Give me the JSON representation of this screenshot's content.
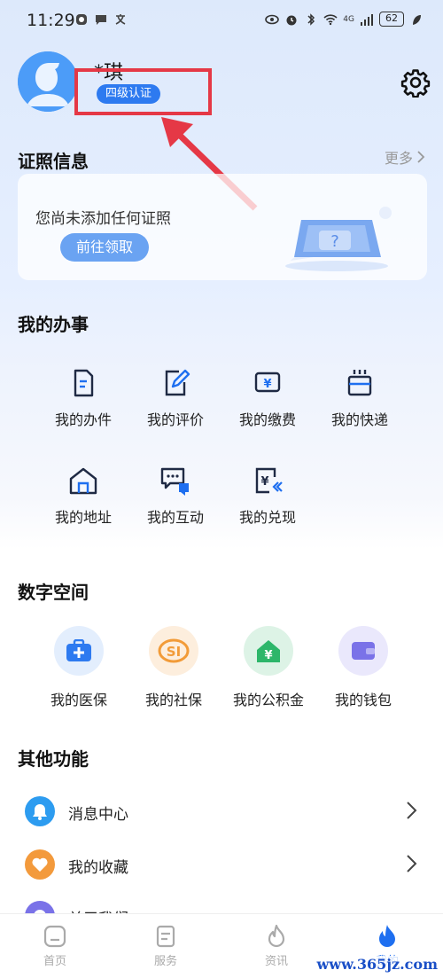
{
  "status_bar": {
    "time": "11:29",
    "battery": "62",
    "network": "4G"
  },
  "profile": {
    "username": "*琪",
    "certification": "四级认证"
  },
  "certificates": {
    "title": "证照信息",
    "more": "更多",
    "empty_text": "您尚未添加任何证照",
    "action_button": "前往领取"
  },
  "my_affairs": {
    "title": "我的办事",
    "items": [
      {
        "label": "我的办件",
        "icon": "document-icon"
      },
      {
        "label": "我的评价",
        "icon": "edit-icon"
      },
      {
        "label": "我的缴费",
        "icon": "payment-icon"
      },
      {
        "label": "我的快递",
        "icon": "express-icon"
      },
      {
        "label": "我的地址",
        "icon": "home-icon"
      },
      {
        "label": "我的互动",
        "icon": "chat-icon"
      },
      {
        "label": "我的兑现",
        "icon": "redeem-icon"
      }
    ]
  },
  "digital_space": {
    "title": "数字空间",
    "items": [
      {
        "label": "我的医保",
        "icon": "medical-insurance-icon",
        "color": "#2d7af0"
      },
      {
        "label": "我的社保",
        "icon": "social-security-icon",
        "color": "#f29b38"
      },
      {
        "label": "我的公积金",
        "icon": "housing-fund-icon",
        "color": "#2db66a"
      },
      {
        "label": "我的钱包",
        "icon": "wallet-icon",
        "color": "#7a72e8"
      }
    ]
  },
  "other_functions": {
    "title": "其他功能",
    "items": [
      {
        "label": "消息中心",
        "icon": "bell-icon",
        "color": "#2d9cf0"
      },
      {
        "label": "我的收藏",
        "icon": "heart-icon",
        "color": "#f39a3c"
      },
      {
        "label": "关于我们",
        "icon": "info-icon",
        "color": "#7a72e8"
      }
    ]
  },
  "tab_bar": {
    "tabs": [
      {
        "label": "首页",
        "icon": "home-tab-icon"
      },
      {
        "label": "服务",
        "icon": "service-tab-icon"
      },
      {
        "label": "资讯",
        "icon": "news-tab-icon"
      },
      {
        "label": "我的",
        "icon": "mine-tab-icon",
        "active": true
      }
    ]
  },
  "watermark": "www.365jz.com",
  "colors": {
    "primary": "#2d7af0",
    "highlight": "#e53846"
  }
}
